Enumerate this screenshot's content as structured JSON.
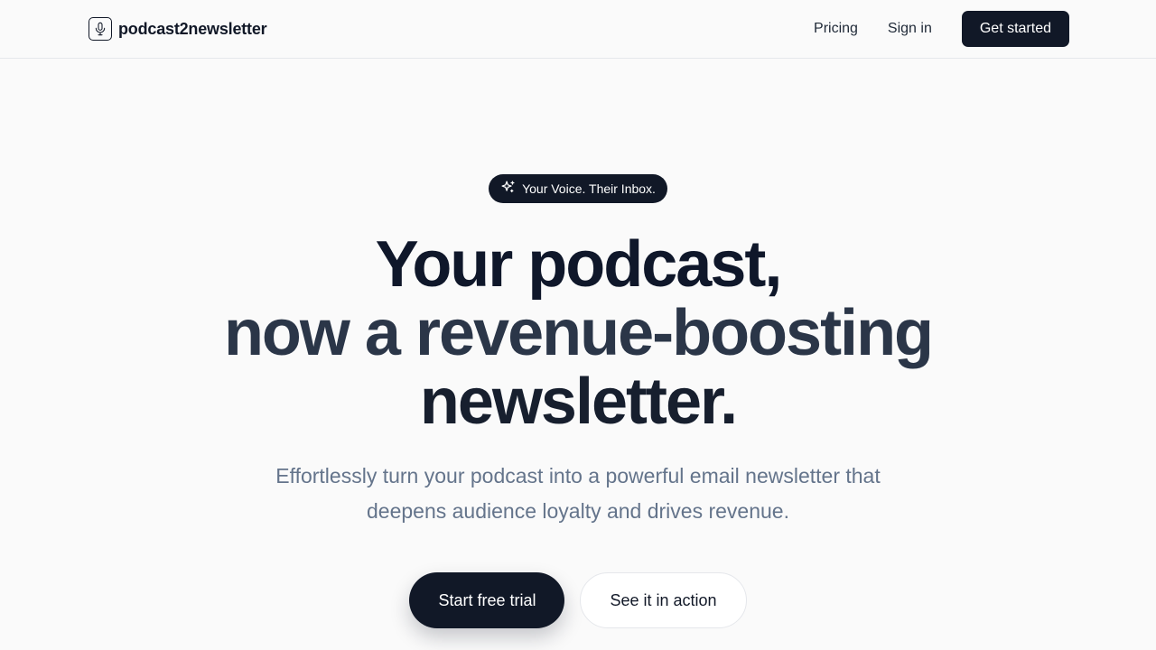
{
  "brand": {
    "name": "podcast2newsletter",
    "logo_icon": "microphone-icon"
  },
  "nav": {
    "pricing": "Pricing",
    "sign_in": "Sign in",
    "get_started": "Get started"
  },
  "hero": {
    "badge_icon": "sparkles-icon",
    "badge_text": "Your Voice. Their Inbox.",
    "headline_line1": "Your podcast,",
    "headline_line2": "now a revenue-boosting",
    "headline_line3": "newsletter.",
    "subtitle_line1": "Effortlessly turn your podcast into a powerful email newsletter that",
    "subtitle_line2": "deepens audience loyalty and drives revenue.",
    "cta_primary": "Start free trial",
    "cta_secondary": "See it in action"
  },
  "colors": {
    "background": "#fafafa",
    "primary": "#111827",
    "muted_text": "#64748b"
  }
}
